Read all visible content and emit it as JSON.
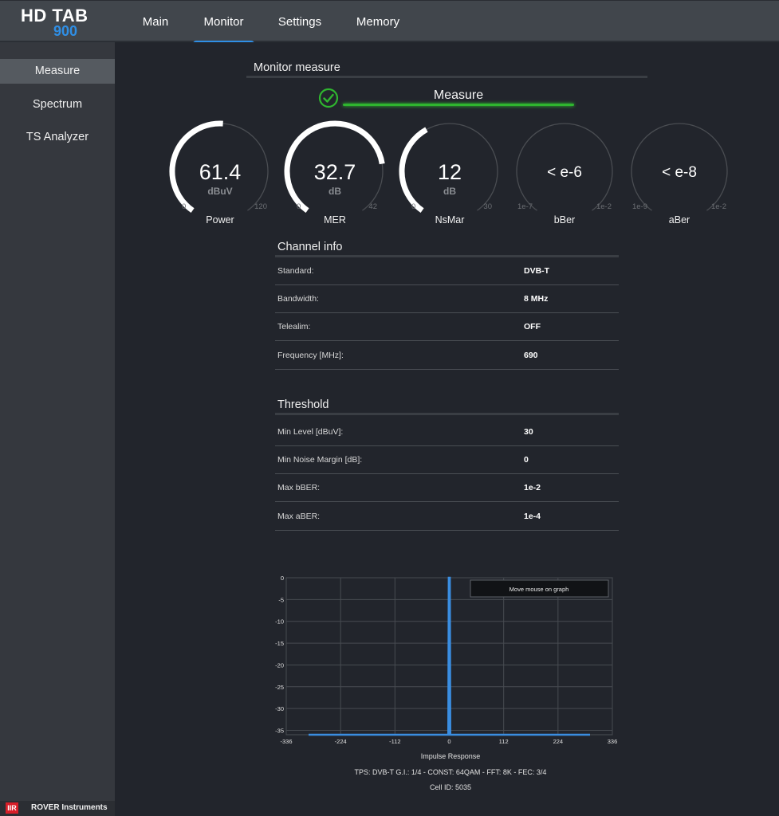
{
  "app": {
    "logo_line1": "HD TAB",
    "logo_line2": "900",
    "brand_accent": "#2f8fe6"
  },
  "nav": {
    "tabs": [
      {
        "label": "Main",
        "active": false
      },
      {
        "label": "Monitor",
        "active": true
      },
      {
        "label": "Settings",
        "active": false
      },
      {
        "label": "Memory",
        "active": false
      }
    ]
  },
  "sidebar": {
    "items": [
      {
        "label": "Measure",
        "active": true
      },
      {
        "label": "Spectrum",
        "active": false
      },
      {
        "label": "TS Analyzer",
        "active": false
      }
    ],
    "footer": {
      "logo": "IIR",
      "company": "ROVER Instruments"
    }
  },
  "monitor": {
    "section_title": "Monitor measure",
    "status": {
      "label": "Measure",
      "state": "ok",
      "color": "#2fb52f"
    }
  },
  "gauges": [
    {
      "name": "Power",
      "value": "61.4",
      "unit": "dBuV",
      "min": "0",
      "max": "120",
      "fraction": 0.512
    },
    {
      "name": "MER",
      "value": "32.7",
      "unit": "dB",
      "min": "0",
      "max": "42",
      "fraction": 0.779
    },
    {
      "name": "NsMar",
      "value": "12",
      "unit": "dB",
      "min": "0",
      "max": "30",
      "fraction": 0.4
    },
    {
      "name": "bBer",
      "value": "< e-6",
      "unit": "",
      "min": "1e-7",
      "max": "1e-2",
      "fraction": 0
    },
    {
      "name": "aBer",
      "value": "< e-8",
      "unit": "",
      "min": "1e-9",
      "max": "1e-2",
      "fraction": 0
    }
  ],
  "channel_info": {
    "title": "Channel info",
    "rows": [
      {
        "label": "Standard:",
        "value": "DVB-T"
      },
      {
        "label": "Bandwidth:",
        "value": "8 MHz"
      },
      {
        "label": "Telealim:",
        "value": "OFF"
      },
      {
        "label": "Frequency [MHz]:",
        "value": "690"
      }
    ]
  },
  "threshold": {
    "title": "Threshold",
    "rows": [
      {
        "label": "Min Level [dBuV]:",
        "value": "30"
      },
      {
        "label": "Min Noise Margin [dB]:",
        "value": "0"
      },
      {
        "label": "Max bBER:",
        "value": "1e-2"
      },
      {
        "label": "Max aBER:",
        "value": "1e-4"
      }
    ]
  },
  "chart_data": {
    "type": "line",
    "title": "Impulse Response",
    "xlabel": "Impulse Response",
    "ylabel": "",
    "xlim": [
      -336,
      336
    ],
    "ylim": [
      -36,
      0
    ],
    "x_ticks": [
      "-336",
      "-224",
      "-112",
      "0",
      "112",
      "224",
      "336"
    ],
    "y_ticks": [
      "0",
      "-5",
      "-10",
      "-15",
      "-20",
      "-25",
      "-30",
      "-35"
    ],
    "grid": true,
    "series": [
      {
        "name": "impulse",
        "color": "#3a8de0",
        "x": [
          -290,
          -2,
          -1,
          0,
          1,
          2,
          290
        ],
        "y": [
          -36,
          -36,
          0,
          0,
          0,
          -36,
          -36
        ]
      }
    ],
    "tooltip": "Move mouse on graph"
  },
  "captions": {
    "tps": "TPS: DVB-T G.I.: 1/4 - CONST: 64QAM - FFT: 8K - FEC: 3/4",
    "cell_id": "Cell ID: 5035"
  }
}
